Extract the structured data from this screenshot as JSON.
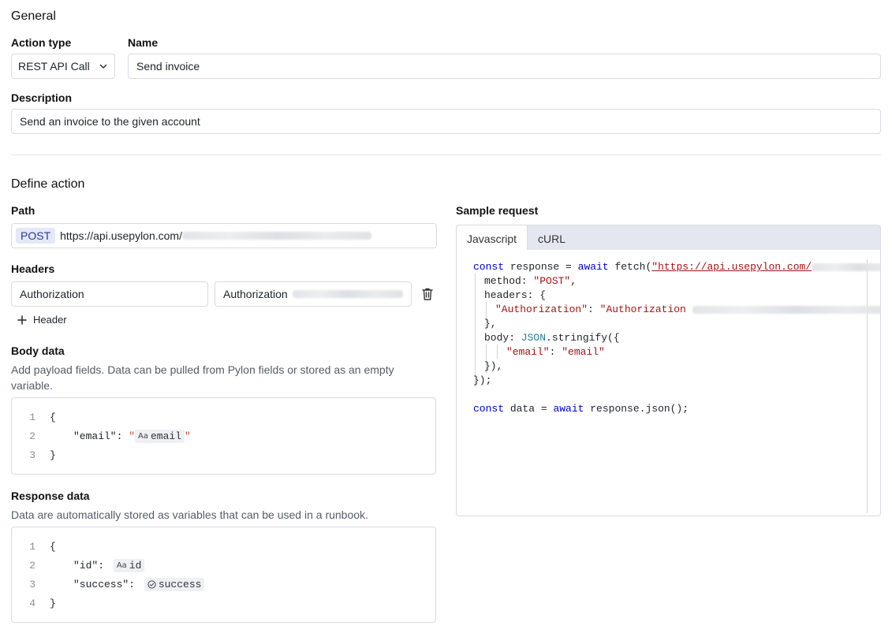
{
  "general": {
    "title": "General",
    "action_type_label": "Action type",
    "action_type_value": "REST API Call",
    "name_label": "Name",
    "name_value": "Send invoice",
    "description_label": "Description",
    "description_value": "Send an invoice to the given account"
  },
  "define": {
    "title": "Define action",
    "path_label": "Path",
    "method": "POST",
    "url_visible": "https://api.usepylon.com/",
    "headers_label": "Headers",
    "header_key": "Authorization",
    "header_value_prefix": "Authorization",
    "add_header_label": "Header",
    "body_label": "Body data",
    "body_help": "Add payload fields. Data can be pulled from Pylon fields or stored as an empty variable.",
    "body_lines": [
      {
        "n": "1",
        "text": "{"
      },
      {
        "n": "2",
        "key": "\"email\": ",
        "pill": "email",
        "pill_icon": "Aa"
      },
      {
        "n": "3",
        "text": "}"
      }
    ],
    "response_label": "Response data",
    "response_help": "Data are automatically stored as variables that can be used in a runbook.",
    "response_lines": [
      {
        "n": "1",
        "text": "{"
      },
      {
        "n": "2",
        "key": "\"id\": ",
        "pill": "id",
        "pill_icon": "Aa"
      },
      {
        "n": "3",
        "key": "\"success\": ",
        "pill": "success",
        "pill_icon": "check-circle"
      },
      {
        "n": "4",
        "text": "}"
      }
    ]
  },
  "sample": {
    "title": "Sample request",
    "tabs": [
      "Javascript",
      "cURL"
    ],
    "active_tab": "Javascript",
    "code": {
      "l1_kw1": "const",
      "l1_id": " response = ",
      "l1_kw2": "await",
      "l1_fn": " fetch(",
      "l1_url": "\"https://api.usepylon.com/",
      "l2_key": "method: ",
      "l2_val": "\"POST\"",
      "l2_end": ",",
      "l3": "headers: {",
      "l4_key": "\"Authorization\"",
      "l4_colon": ": ",
      "l4_val": "\"Authorization ",
      "l5": "},",
      "l6_key": "body: ",
      "l6_json": "JSON",
      "l6_rest": ".stringify({",
      "l7_key": "\"email\"",
      "l7_colon": ": ",
      "l7_val": "\"email\"",
      "l8": "}),",
      "l9": "});",
      "l11_kw1": "const",
      "l11_id": " data = ",
      "l11_kw2": "await",
      "l11_rest": " response.json();"
    }
  },
  "icons": {
    "chevron": "chevron-down-icon",
    "trash": "trash-icon",
    "plus": "plus-icon"
  }
}
